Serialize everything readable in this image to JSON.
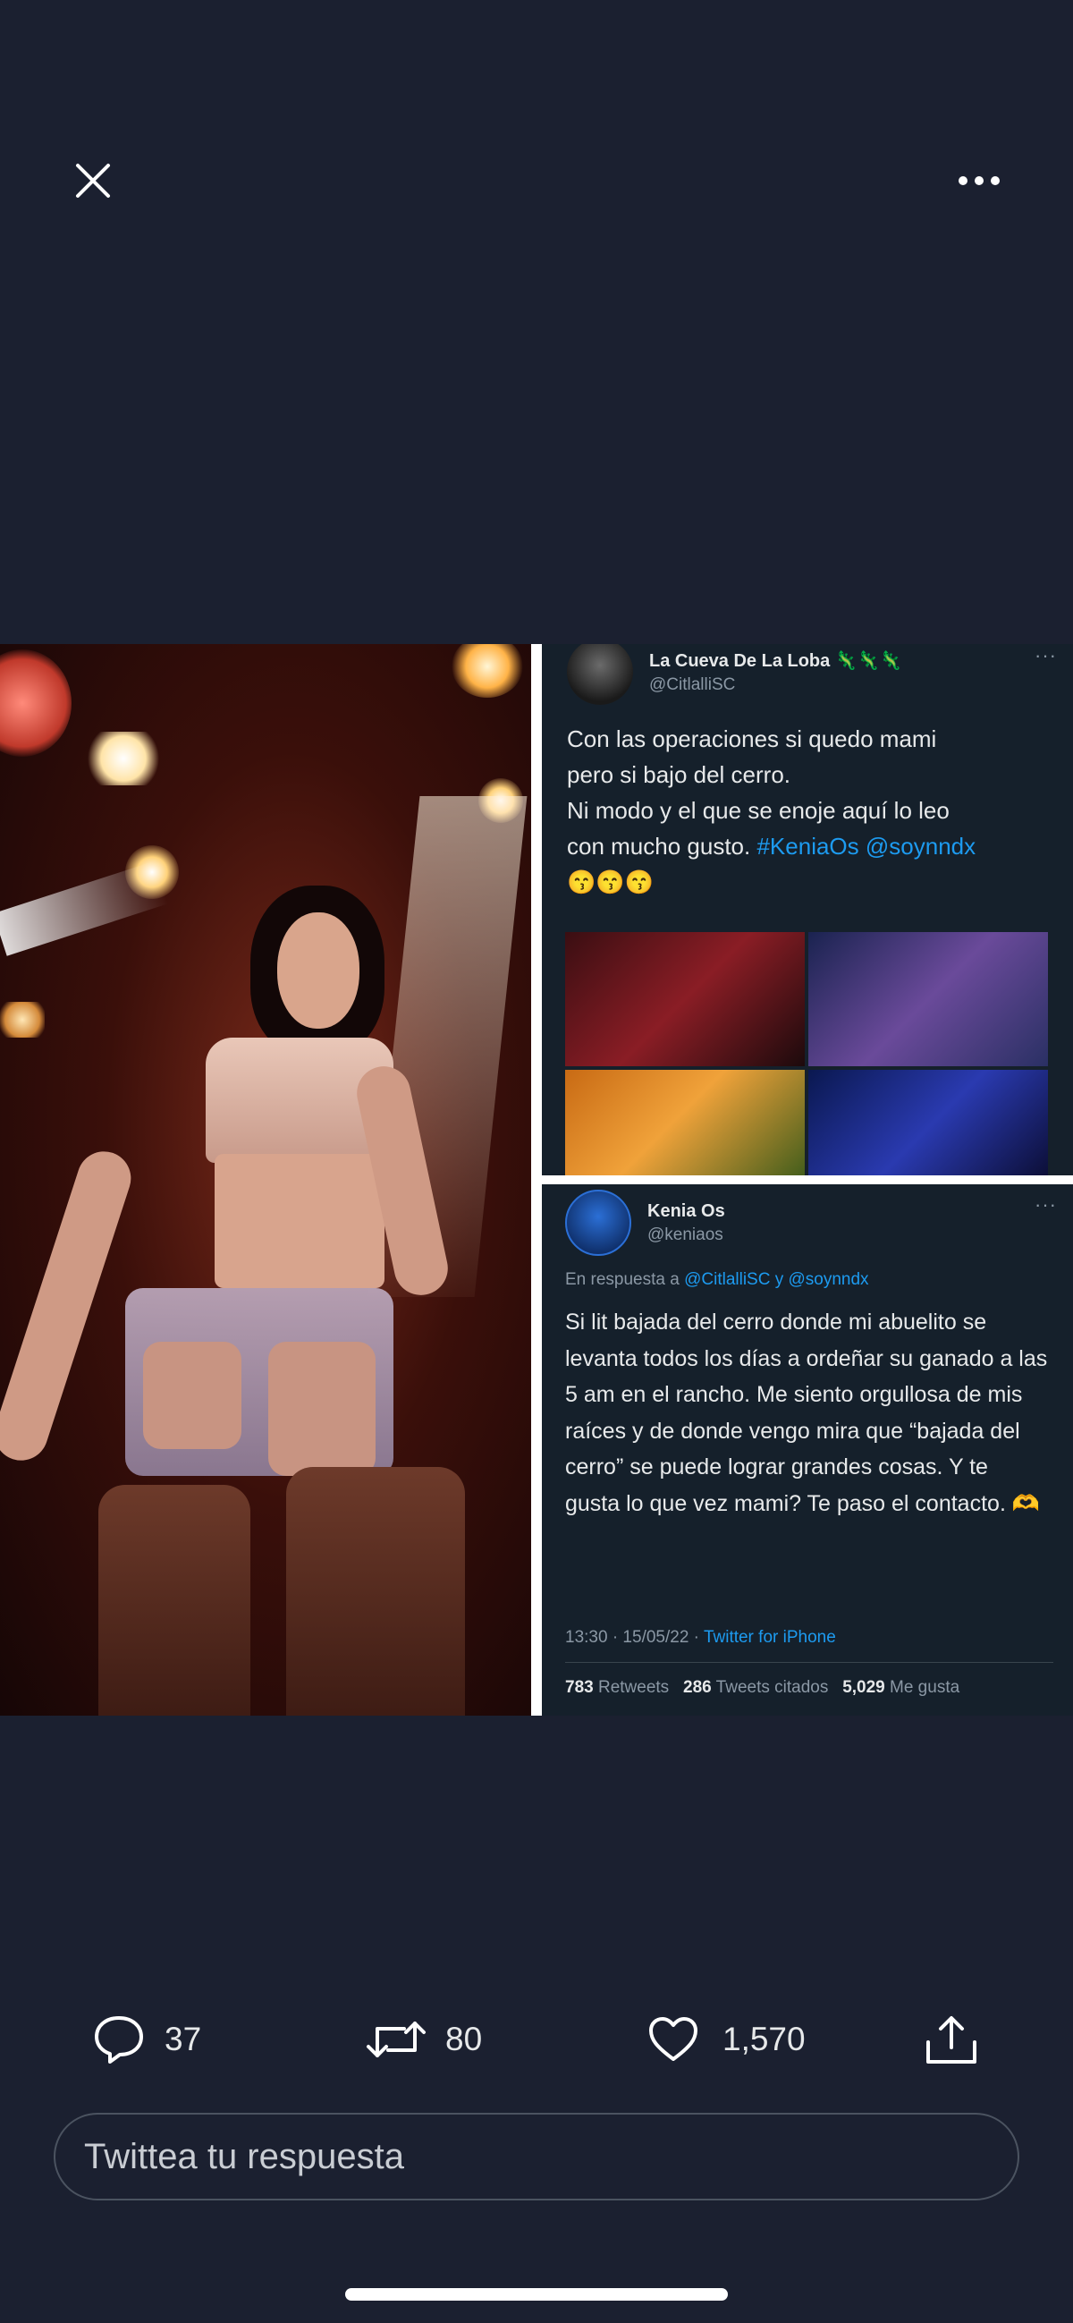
{
  "actions": {
    "replies": "37",
    "retweets": "80",
    "likes": "1,570"
  },
  "reply_placeholder": "Twittea tu respuesta",
  "embedded_tweet_1": {
    "name": "La Cueva De La Loba 🦎🦎🦎",
    "handle": "@CitlalliSC",
    "text_line1": "Con las operaciones si quedo mami",
    "text_line2": "pero si bajo del cerro.",
    "text_line3": "Ni modo y el que se enoje aquí  lo leo",
    "text_line4_plain": "con mucho gusto. ",
    "hashtag": "#KeniaOs",
    "mention": "@soynndx",
    "emojis": "😙😙😙"
  },
  "embedded_tweet_2": {
    "name": "Kenia Os",
    "handle": "@keniaos",
    "reply_prefix": "En respuesta a ",
    "reply_to": "@CitlalliSC y @soynndx",
    "text": "Si lit bajada del cerro donde mi abuelito se levanta todos los días a ordeñar su ganado a las 5 am en el rancho. Me siento orgullosa de mis raíces y de donde vengo mira que “bajada del cerro” se puede lograr grandes cosas. Y te gusta lo que vez mami? Te paso el contacto. 🫶",
    "time": "13:30 · 15/05/22 · ",
    "source": "Twitter for iPhone",
    "retweets_num": "783",
    "retweets_label": " Retweets",
    "quotes_num": "286",
    "quotes_label": " Tweets citados",
    "likes_num": "5,029",
    "likes_label": " Me gusta"
  },
  "colors": {
    "background": "#1b2030",
    "link": "#1d9bf0",
    "muted": "#8b98a5"
  },
  "icons": [
    "close-icon",
    "more-icon",
    "reply-icon",
    "retweet-icon",
    "like-icon",
    "share-icon"
  ]
}
